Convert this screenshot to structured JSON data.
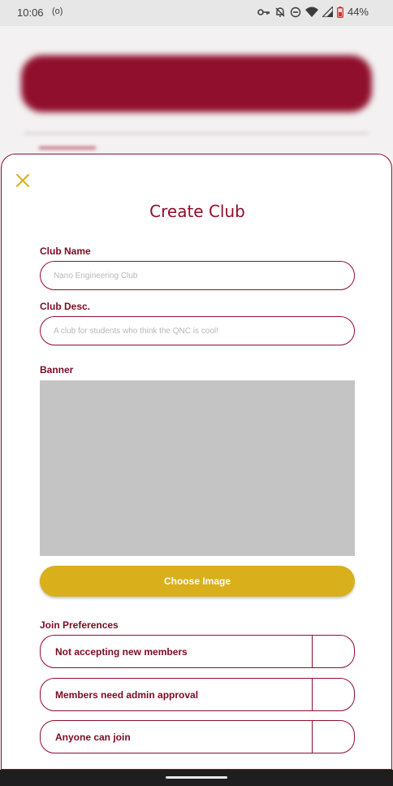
{
  "status_bar": {
    "time": "10:06",
    "indicator": "(o)",
    "battery": "44%",
    "icons": [
      "key-icon",
      "notifications-off-icon",
      "do-not-disturb-icon",
      "wifi-icon",
      "cellular-signal-icon",
      "battery-icon"
    ]
  },
  "dialog": {
    "title": "Create Club",
    "close_icon": "close-icon",
    "club_name": {
      "label": "Club Name",
      "placeholder": "Nano Engineering Club",
      "value": ""
    },
    "club_desc": {
      "label": "Club Desc.",
      "placeholder": "A club for students who think the QNC is cool!",
      "value": ""
    },
    "banner": {
      "label": "Banner"
    },
    "choose_image_label": "Choose Image",
    "join_preferences": {
      "label": "Join Preferences",
      "options": [
        {
          "label": "Not accepting new members",
          "selected": false
        },
        {
          "label": "Members need admin approval",
          "selected": false
        },
        {
          "label": "Anyone can join",
          "selected": false
        }
      ]
    }
  },
  "colors": {
    "primary": "#8f0f2c",
    "accent": "#d9af1c",
    "placeholder_image": "#c4c4c4",
    "close_icon": "#d9af1c"
  }
}
